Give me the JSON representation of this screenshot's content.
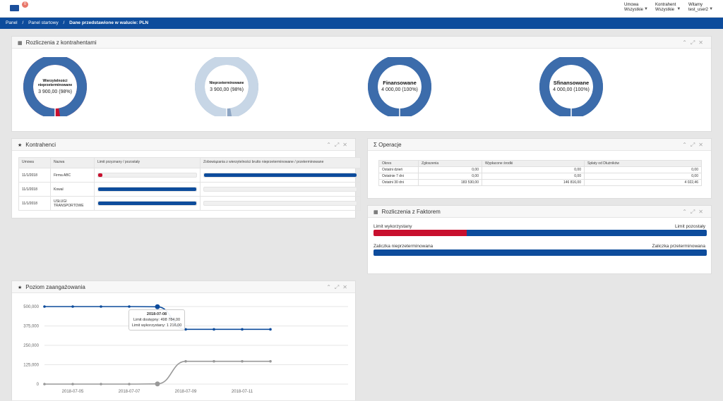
{
  "topbar": {
    "badge": "0",
    "menus": [
      {
        "label": "Umowa",
        "value": "Wszystkie"
      },
      {
        "label": "Kontrahent",
        "value": "Wszystkie"
      },
      {
        "label": "Witamy",
        "value": "test_user2"
      }
    ]
  },
  "breadcrumb": {
    "items": [
      "Panel",
      "Panel startowy",
      "Dane przedstawione w walucie: PLN"
    ],
    "sep": "/"
  },
  "settlements": {
    "title": "Rozliczenia z kontrahentami",
    "donuts": [
      {
        "title": "Wierzytelności nieprzeterminowane",
        "value": "3 900,00 (98%)",
        "percent": 98,
        "color": "#3c6cab",
        "rest_color": "#c8102e"
      },
      {
        "title": "Nieprzeterminowane",
        "value": "3 900,00 (98%)",
        "percent": 98,
        "color": "#c7d6e6",
        "rest_color": "#8ea6c4"
      },
      {
        "title": "Finansowane",
        "value": "4 000,00 (100%)",
        "percent": 100,
        "color": "#3c6cab",
        "rest_color": "#3c6cab"
      },
      {
        "title": "Sfinansowane",
        "value": "4 000,00 (100%)",
        "percent": 100,
        "color": "#3c6cab",
        "rest_color": "#3c6cab"
      }
    ]
  },
  "contractors": {
    "title": "Kontrahenci",
    "headers": [
      "Umowa",
      "Nazwa",
      "Limit przyznany / pozostały",
      "Zobowiązania z wierzytelności brutto nieprzeterminowane / przeterminowane"
    ],
    "rows": [
      {
        "contract": "11/1/2018",
        "name": "Firma ABC",
        "limit_fill": 0.04,
        "limit_color": "#c8102e",
        "obl_fill": 1.0
      },
      {
        "contract": "11/1/2018",
        "name": "Kowal",
        "limit_fill": 1.0,
        "limit_color": "#0d4c9c",
        "obl_fill": 0
      },
      {
        "contract": "11/1/2018",
        "name": "USŁUGI TRANSPORTOWE",
        "limit_fill": 1.0,
        "limit_color": "#0d4c9c",
        "obl_fill": 0
      }
    ]
  },
  "operations": {
    "title": "Σ Operacje",
    "headers": [
      "Okres",
      "Zgłoszenia",
      "Wypłacone środki",
      "Spłaty od Dłużników"
    ],
    "rows": [
      [
        "Ostatni dzień",
        "0,00",
        "0,00",
        "0,00"
      ],
      [
        "Ostatnie 7 dni",
        "0,00",
        "0,00",
        "0,00"
      ],
      [
        "Ostatni 30 dni",
        "183 530,00",
        "146 816,00",
        "4 022,46"
      ]
    ]
  },
  "factor": {
    "title": "Rozliczenia z Faktorem",
    "limit_used_label": "Limit wykorzystany",
    "limit_left_label": "Limit pozostały",
    "limit_used_fraction": 0.28,
    "loan_unexpired_label": "Zaliczka nieprzeterminowana",
    "loan_expired_label": "Zaliczka przeterminowana",
    "loan_unexpired_fraction": 1.0,
    "used_color": "#c8102e",
    "left_color": "#0d4c9c"
  },
  "engagement": {
    "title": "Poziom zaangażowania",
    "tooltip": {
      "date": "2018-07-08",
      "line1": "Limit dostępny: 498 784,00",
      "line2": "Limit wykorzystany: 1 216,00"
    }
  },
  "chart_data": {
    "type": "line",
    "x": [
      "2018-07-04",
      "2018-07-05",
      "2018-07-06",
      "2018-07-07",
      "2018-07-08",
      "2018-07-09",
      "2018-07-10",
      "2018-07-11",
      "2018-07-12"
    ],
    "xticks": [
      "2018-07-05",
      "2018-07-07",
      "2018-07-09",
      "2018-07-11"
    ],
    "yticks": [
      "0",
      "125,000",
      "250,000",
      "375,000",
      "500,000"
    ],
    "ylim": [
      0,
      500000
    ],
    "series": [
      {
        "values": [
          500000,
          500000,
          500000,
          500000,
          498784,
          353000,
          353000,
          353000,
          353000
        ],
        "color": "#0d4c9c"
      },
      {
        "values": [
          0,
          0,
          0,
          0,
          1216,
          147000,
          147000,
          147000,
          147000
        ],
        "color": "#999999"
      }
    ]
  }
}
